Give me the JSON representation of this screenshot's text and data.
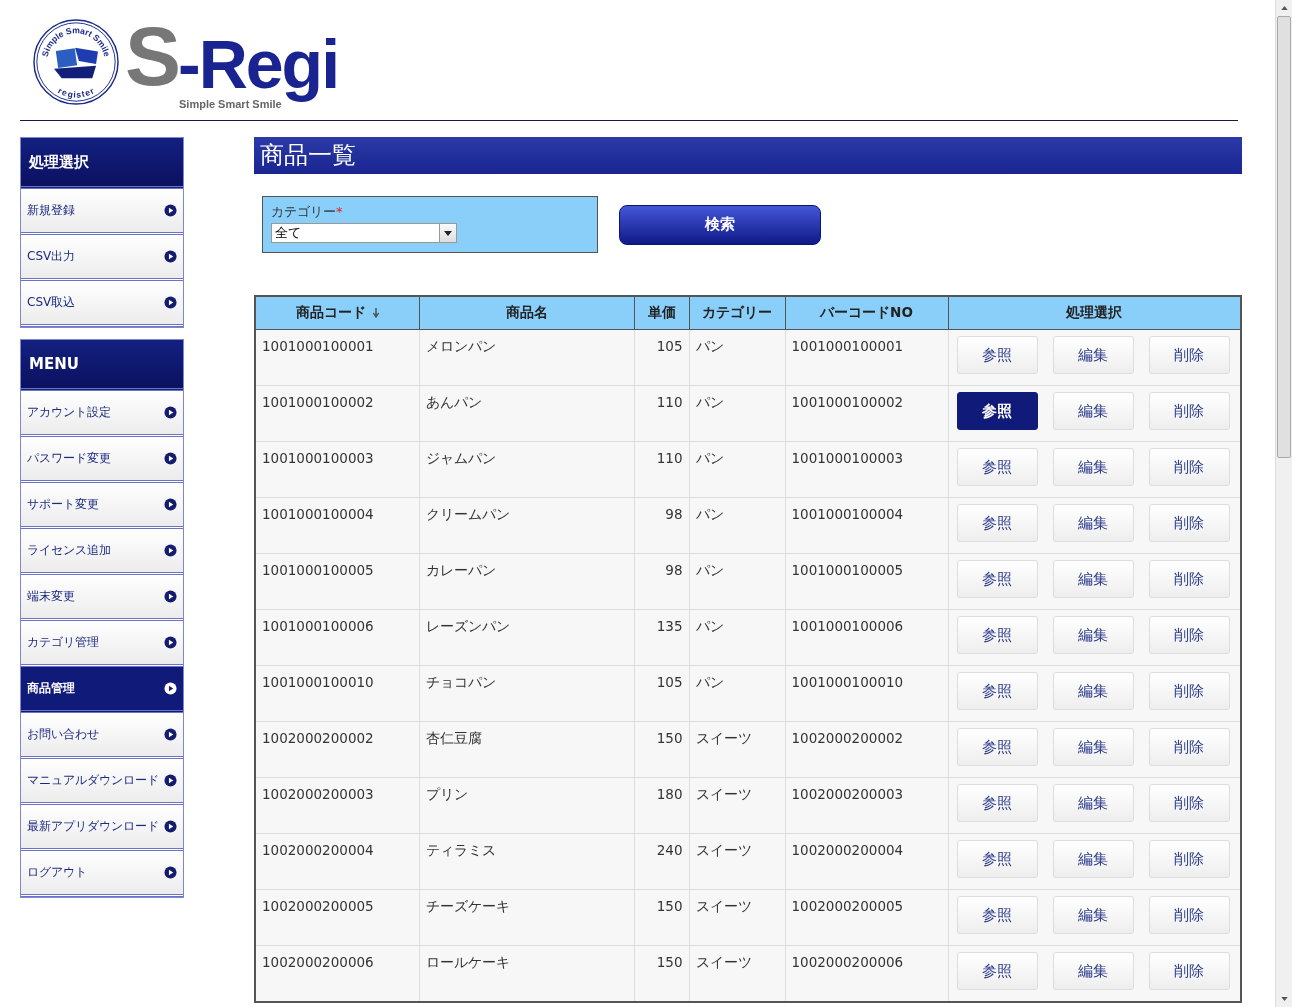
{
  "logo": {
    "emblem_top": "Simple Smart Smile",
    "emblem_bottom": "register",
    "wordmark_s": "S",
    "wordmark_rest": "-Regi",
    "tagline": "Simple Smart Smile"
  },
  "sidebar": {
    "sections": [
      {
        "title": "処理選択",
        "items": [
          {
            "label": "新規登録",
            "selected": false
          },
          {
            "label": "CSV出力",
            "selected": false
          },
          {
            "label": "CSV取込",
            "selected": false
          }
        ]
      },
      {
        "title": "MENU",
        "items": [
          {
            "label": "アカウント設定",
            "selected": false
          },
          {
            "label": "パスワード変更",
            "selected": false
          },
          {
            "label": "サポート変更",
            "selected": false
          },
          {
            "label": "ライセンス追加",
            "selected": false
          },
          {
            "label": "端末変更",
            "selected": false
          },
          {
            "label": "カテゴリ管理",
            "selected": false
          },
          {
            "label": "商品管理",
            "selected": true
          },
          {
            "label": "お問い合わせ",
            "selected": false
          },
          {
            "label": "マニュアルダウンロード",
            "selected": false
          },
          {
            "label": "最新アプリダウンロード",
            "selected": false
          },
          {
            "label": "ログアウト",
            "selected": false
          }
        ]
      }
    ]
  },
  "page_title": "商品一覧",
  "filter": {
    "label": "カテゴリー",
    "required_mark": "*",
    "value": "全て",
    "search_button": "検索"
  },
  "table": {
    "columns": [
      {
        "label": "商品コード",
        "sorted": true
      },
      {
        "label": "商品名",
        "sorted": false
      },
      {
        "label": "単価",
        "sorted": false
      },
      {
        "label": "カテゴリー",
        "sorted": false
      },
      {
        "label": "バーコードNO",
        "sorted": false
      },
      {
        "label": "処理選択",
        "sorted": false
      }
    ],
    "rows": [
      {
        "code": "1001000100001",
        "name": "メロンパン",
        "price": "105",
        "category": "パン",
        "barcode": "1001000100001",
        "actions": [
          {
            "label": "参照",
            "highlighted": false
          },
          {
            "label": "編集",
            "highlighted": false
          },
          {
            "label": "削除",
            "highlighted": false
          }
        ]
      },
      {
        "code": "1001000100002",
        "name": "あんパン",
        "price": "110",
        "category": "パン",
        "barcode": "1001000100002",
        "actions": [
          {
            "label": "参照",
            "highlighted": true
          },
          {
            "label": "編集",
            "highlighted": false
          },
          {
            "label": "削除",
            "highlighted": false
          }
        ]
      },
      {
        "code": "1001000100003",
        "name": "ジャムパン",
        "price": "110",
        "category": "パン",
        "barcode": "1001000100003",
        "actions": [
          {
            "label": "参照",
            "highlighted": false
          },
          {
            "label": "編集",
            "highlighted": false
          },
          {
            "label": "削除",
            "highlighted": false
          }
        ]
      },
      {
        "code": "1001000100004",
        "name": "クリームパン",
        "price": "98",
        "category": "パン",
        "barcode": "1001000100004",
        "actions": [
          {
            "label": "参照",
            "highlighted": false
          },
          {
            "label": "編集",
            "highlighted": false
          },
          {
            "label": "削除",
            "highlighted": false
          }
        ]
      },
      {
        "code": "1001000100005",
        "name": "カレーパン",
        "price": "98",
        "category": "パン",
        "barcode": "1001000100005",
        "actions": [
          {
            "label": "参照",
            "highlighted": false
          },
          {
            "label": "編集",
            "highlighted": false
          },
          {
            "label": "削除",
            "highlighted": false
          }
        ]
      },
      {
        "code": "1001000100006",
        "name": "レーズンパン",
        "price": "135",
        "category": "パン",
        "barcode": "1001000100006",
        "actions": [
          {
            "label": "参照",
            "highlighted": false
          },
          {
            "label": "編集",
            "highlighted": false
          },
          {
            "label": "削除",
            "highlighted": false
          }
        ]
      },
      {
        "code": "1001000100010",
        "name": "チョコパン",
        "price": "105",
        "category": "パン",
        "barcode": "1001000100010",
        "actions": [
          {
            "label": "参照",
            "highlighted": false
          },
          {
            "label": "編集",
            "highlighted": false
          },
          {
            "label": "削除",
            "highlighted": false
          }
        ]
      },
      {
        "code": "1002000200002",
        "name": "杏仁豆腐",
        "price": "150",
        "category": "スイーツ",
        "barcode": "1002000200002",
        "actions": [
          {
            "label": "参照",
            "highlighted": false
          },
          {
            "label": "編集",
            "highlighted": false
          },
          {
            "label": "削除",
            "highlighted": false
          }
        ]
      },
      {
        "code": "1002000200003",
        "name": "プリン",
        "price": "180",
        "category": "スイーツ",
        "barcode": "1002000200003",
        "actions": [
          {
            "label": "参照",
            "highlighted": false
          },
          {
            "label": "編集",
            "highlighted": false
          },
          {
            "label": "削除",
            "highlighted": false
          }
        ]
      },
      {
        "code": "1002000200004",
        "name": "ティラミス",
        "price": "240",
        "category": "スイーツ",
        "barcode": "1002000200004",
        "actions": [
          {
            "label": "参照",
            "highlighted": false
          },
          {
            "label": "編集",
            "highlighted": false
          },
          {
            "label": "削除",
            "highlighted": false
          }
        ]
      },
      {
        "code": "1002000200005",
        "name": "チーズケーキ",
        "price": "150",
        "category": "スイーツ",
        "barcode": "1002000200005",
        "actions": [
          {
            "label": "参照",
            "highlighted": false
          },
          {
            "label": "編集",
            "highlighted": false
          },
          {
            "label": "削除",
            "highlighted": false
          }
        ]
      },
      {
        "code": "1002000200006",
        "name": "ロールケーキ",
        "price": "150",
        "category": "スイーツ",
        "barcode": "1002000200006",
        "actions": [
          {
            "label": "参照",
            "highlighted": false
          },
          {
            "label": "編集",
            "highlighted": false
          },
          {
            "label": "削除",
            "highlighted": false
          }
        ]
      }
    ]
  }
}
